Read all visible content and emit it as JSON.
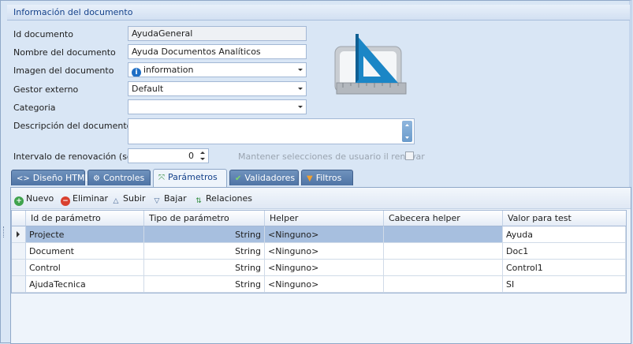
{
  "group": {
    "title": "Información del documento"
  },
  "form": {
    "id_label": "Id documento",
    "id_value": "AyudaGeneral",
    "name_label": "Nombre del documento",
    "name_value": "Ayuda Documentos Analíticos",
    "image_label": "Imagen del documento",
    "image_value": "information",
    "image_icon": "info-circle-icon",
    "manager_label": "Gestor externo",
    "manager_value": "Default",
    "category_label": "Categoria",
    "category_value": "",
    "desc_label": "Descripción del documento",
    "desc_value": "",
    "interval_label": "Intervalo de renovación (sg)",
    "interval_value": "0",
    "keep_sel_label": "Mantener selecciones de usuario il renovar"
  },
  "illustration_icon": "set-square-ruler-icon",
  "tabs": [
    {
      "label": "Diseño HTML",
      "icon": "code-icon"
    },
    {
      "label": "Controles",
      "icon": "gear-icon"
    },
    {
      "label": "Parámetros",
      "icon": "parameters-icon",
      "active": true
    },
    {
      "label": "Validadores",
      "icon": "check-icon"
    },
    {
      "label": "Filtros",
      "icon": "funnel-icon"
    }
  ],
  "toolbar": {
    "new_label": "Nuevo",
    "delete_label": "Eliminar",
    "up_label": "Subir",
    "down_label": "Bajar",
    "relations_label": "Relaciones"
  },
  "grid": {
    "columns": [
      "Id de parámetro",
      "Tipo de parámetro",
      "Helper",
      "Cabecera helper",
      "Valor para test"
    ],
    "rows": [
      [
        "Projecte",
        "String",
        "<Ninguno>",
        "",
        "Ayuda"
      ],
      [
        "Document",
        "String",
        "<Ninguno>",
        "",
        "Doc1"
      ],
      [
        "Control",
        "String",
        "<Ninguno>",
        "",
        "Control1"
      ],
      [
        "AjudaTecnica",
        "String",
        "<Ninguno>",
        "",
        "SI"
      ]
    ],
    "selected_row": 0
  },
  "colors": {
    "tab_bg": "#5b7fae",
    "selection": "#a7bfdf",
    "header_text": "#15428b"
  }
}
